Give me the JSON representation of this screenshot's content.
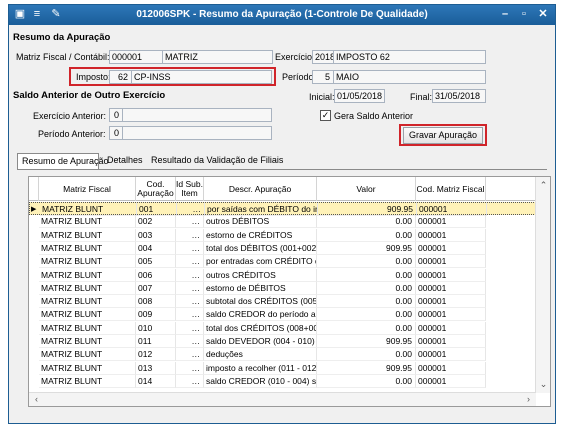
{
  "window": {
    "title": "012006SPK - Resumo da Apuração (1-Controle De Qualidade)",
    "toolbar_icons": [
      "save-icon",
      "traffic-light-icon",
      "wrench-icon"
    ],
    "controls": {
      "minimize": "–",
      "restore": "▫",
      "close": "✕"
    }
  },
  "resumo": {
    "section_title": "Resumo da Apuração",
    "matriz_label": "Matriz Fiscal / Contábil:",
    "matriz_code": "000001",
    "matriz_name": "MATRIZ",
    "exercicio_label": "Exercício:",
    "exercicio_code": "2018",
    "exercicio_name": "IMPOSTO 62",
    "imposto_label": "Imposto:",
    "imposto_code": "62",
    "imposto_name": "CP-INSS",
    "periodo_label": "Período:",
    "periodo_code": "5",
    "periodo_name": "MAIO",
    "inicial_label": "Inicial:",
    "inicial_value": "01/05/2018",
    "final_label": "Final:",
    "final_value": "31/05/2018"
  },
  "saldo": {
    "section_title": "Saldo Anterior de Outro Exercício",
    "exercicio_anterior_label": "Exercício Anterior:",
    "exercicio_anterior_value": "0",
    "periodo_anterior_label": "Período Anterior:",
    "periodo_anterior_value": "0",
    "gera_saldo_label": "Gera Saldo Anterior",
    "gera_saldo_checked": "✓",
    "gravar_button": "Gravar Apuração"
  },
  "tabs": [
    "Resumo de Apuração",
    "Detalhes",
    "Resultado da Validação de Filiais"
  ],
  "grid": {
    "columns": [
      "Matriz Fiscal",
      "Cod. Apuração",
      "Id Sub. Item",
      "Descr. Apuração",
      "Valor",
      "Cod. Matriz Fiscal"
    ],
    "rows": [
      {
        "matriz": "MATRIZ BLUNT",
        "cod": "001",
        "sub": "…",
        "descr": "por saídas com DÉBITO do impos",
        "valor": "909.95",
        "cod_matriz": "000001"
      },
      {
        "matriz": "MATRIZ BLUNT",
        "cod": "002",
        "sub": "…",
        "descr": "outros DÉBITOS",
        "valor": "0.00",
        "cod_matriz": "000001"
      },
      {
        "matriz": "MATRIZ BLUNT",
        "cod": "003",
        "sub": "…",
        "descr": "estorno de CRÉDITOS",
        "valor": "0.00",
        "cod_matriz": "000001"
      },
      {
        "matriz": "MATRIZ BLUNT",
        "cod": "004",
        "sub": "…",
        "descr": "total dos DÉBITOS (001+002+0",
        "valor": "909.95",
        "cod_matriz": "000001"
      },
      {
        "matriz": "MATRIZ BLUNT",
        "cod": "005",
        "sub": "…",
        "descr": "por entradas com CRÉDITO do i",
        "valor": "0.00",
        "cod_matriz": "000001"
      },
      {
        "matriz": "MATRIZ BLUNT",
        "cod": "006",
        "sub": "…",
        "descr": "outros CRÉDITOS",
        "valor": "0.00",
        "cod_matriz": "000001"
      },
      {
        "matriz": "MATRIZ BLUNT",
        "cod": "007",
        "sub": "…",
        "descr": "estorno de DÉBITOS",
        "valor": "0.00",
        "cod_matriz": "000001"
      },
      {
        "matriz": "MATRIZ BLUNT",
        "cod": "008",
        "sub": "…",
        "descr": "subtotal dos CRÉDITOS (005+0",
        "valor": "0.00",
        "cod_matriz": "000001"
      },
      {
        "matriz": "MATRIZ BLUNT",
        "cod": "009",
        "sub": "…",
        "descr": "saldo CREDOR do período anter",
        "valor": "0.00",
        "cod_matriz": "000001"
      },
      {
        "matriz": "MATRIZ BLUNT",
        "cod": "010",
        "sub": "…",
        "descr": "total dos CRÉDITOS (008+009)",
        "valor": "0.00",
        "cod_matriz": "000001"
      },
      {
        "matriz": "MATRIZ BLUNT",
        "cod": "011",
        "sub": "…",
        "descr": "saldo DEVEDOR (004 - 010) se D",
        "valor": "909.95",
        "cod_matriz": "000001"
      },
      {
        "matriz": "MATRIZ BLUNT",
        "cod": "012",
        "sub": "…",
        "descr": "deduções",
        "valor": "0.00",
        "cod_matriz": "000001"
      },
      {
        "matriz": "MATRIZ BLUNT",
        "cod": "013",
        "sub": "…",
        "descr": "imposto a recolher (011 - 012)",
        "valor": "909.95",
        "cod_matriz": "000001"
      },
      {
        "matriz": "MATRIZ BLUNT",
        "cod": "014",
        "sub": "…",
        "descr": "saldo CREDOR (010 - 004) se 0<",
        "valor": "0.00",
        "cod_matriz": "000001"
      }
    ]
  },
  "colors": {
    "accent": "#2e77b8",
    "highlight": "#d0242a",
    "selected_row": "#fff2b8"
  }
}
